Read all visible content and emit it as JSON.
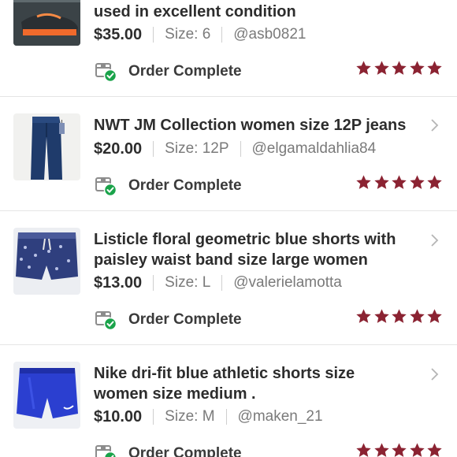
{
  "orders": [
    {
      "title_lines": [
        "used in excellent condition"
      ],
      "price": "$35.00",
      "size": "Size: 6",
      "seller": "@asb0821",
      "status": "Order Complete",
      "rating": 5,
      "thumb_icon": "sneaker-photo"
    },
    {
      "title_lines": [
        "NWT JM Collection women size 12P jeans"
      ],
      "price": "$20.00",
      "size": "Size: 12P",
      "seller": "@elgamaldahlia84",
      "status": "Order Complete",
      "rating": 5,
      "thumb_icon": "jeans-photo"
    },
    {
      "title_lines": [
        "Listicle floral geometric blue shorts with",
        "paisley waist band size large women"
      ],
      "price": "$13.00",
      "size": "Size: L",
      "seller": "@valerielamotta",
      "status": "Order Complete",
      "rating": 5,
      "thumb_icon": "floral-shorts-photo"
    },
    {
      "title_lines": [
        "Nike dri-fit blue athletic shorts size",
        "women size medium ."
      ],
      "price": "$10.00",
      "size": "Size: M",
      "seller": "@maken_21",
      "status": "Order Complete",
      "rating": 5,
      "thumb_icon": "athletic-shorts-photo"
    }
  ],
  "colors": {
    "star": "#8b2332",
    "check": "#1aa34a",
    "divider": "#e5e5e5"
  }
}
